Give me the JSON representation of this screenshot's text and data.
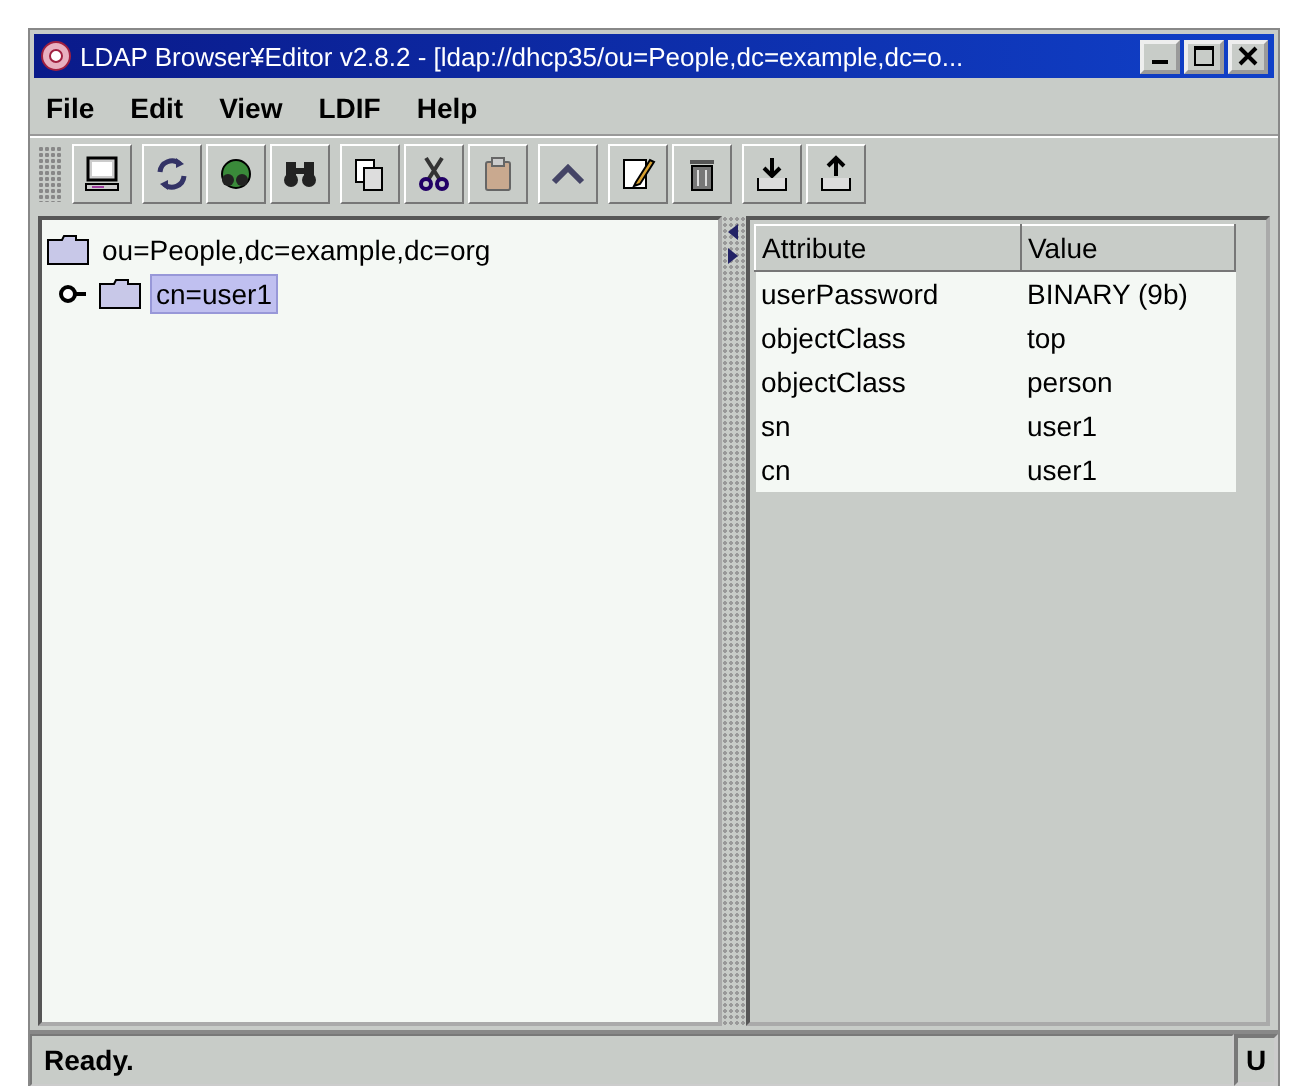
{
  "window": {
    "title": "LDAP Browser¥Editor v2.8.2 - [ldap://dhcp35/ou=People,dc=example,dc=o..."
  },
  "menu": [
    {
      "label": "File"
    },
    {
      "label": "Edit"
    },
    {
      "label": "View"
    },
    {
      "label": "LDIF"
    },
    {
      "label": "Help"
    }
  ],
  "tree": {
    "label": "ou=People,dc=example,dc=org",
    "selected": false,
    "children": [
      {
        "label": "cn=user1",
        "selected": true
      }
    ]
  },
  "table": {
    "columns": [
      "Attribute",
      "Value"
    ],
    "rows": [
      [
        "userPassword",
        "BINARY (9b)"
      ],
      [
        "objectClass",
        "top"
      ],
      [
        "objectClass",
        "person"
      ],
      [
        "sn",
        "user1"
      ],
      [
        "cn",
        "user1"
      ]
    ]
  },
  "status_bar": {
    "message": "Ready.",
    "indicator": "U"
  }
}
